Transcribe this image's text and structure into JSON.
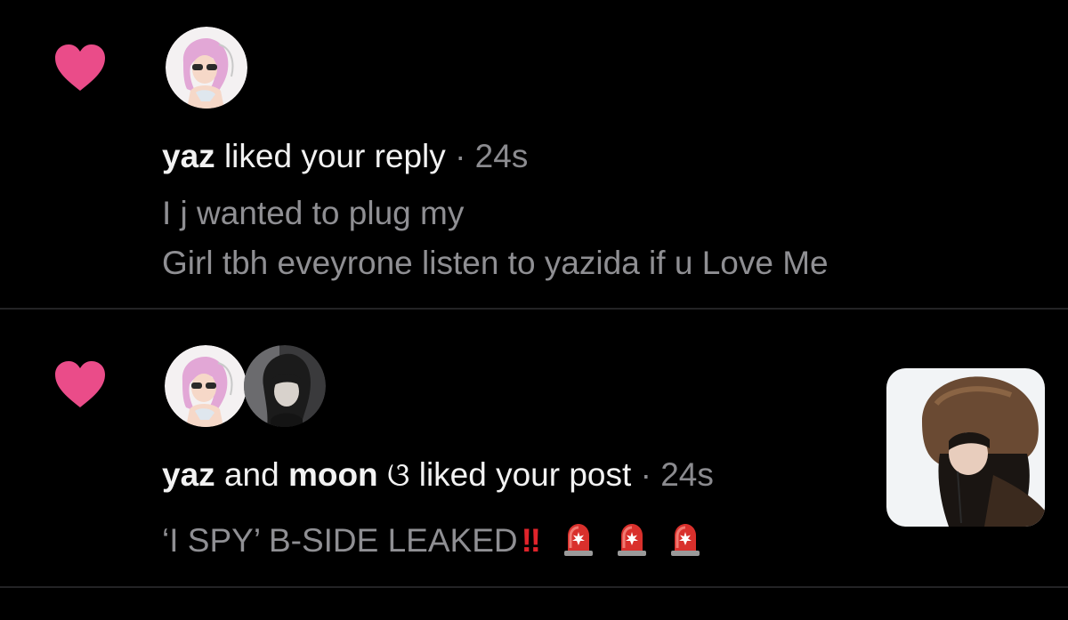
{
  "notifications": [
    {
      "actor_1": "yaz",
      "connector": "",
      "actor_2": "",
      "action": "liked your reply",
      "separator": "·",
      "time": "24s",
      "body_lines": [
        "I j wanted to plug my",
        "Girl tbh eveyrone listen to yazida if u Love Me"
      ],
      "icon": "heart-icon"
    },
    {
      "actor_1": "yaz",
      "connector": "and",
      "actor_2": "moon",
      "actor_2_suffix": "ଓ",
      "action": "liked your post",
      "separator": "·",
      "time": "24s",
      "body_text": "‘I SPY’ B-SIDE LEAKED",
      "exclamation": "‼",
      "emojis": [
        "siren-icon",
        "siren-icon",
        "siren-icon"
      ],
      "icon": "heart-icon"
    }
  ],
  "colors": {
    "background": "#000000",
    "heart": "#ea4c89",
    "primary_text": "#f2f2f2",
    "secondary_text": "#8f8f93",
    "divider": "#232325",
    "exclamation": "#e0242b"
  }
}
